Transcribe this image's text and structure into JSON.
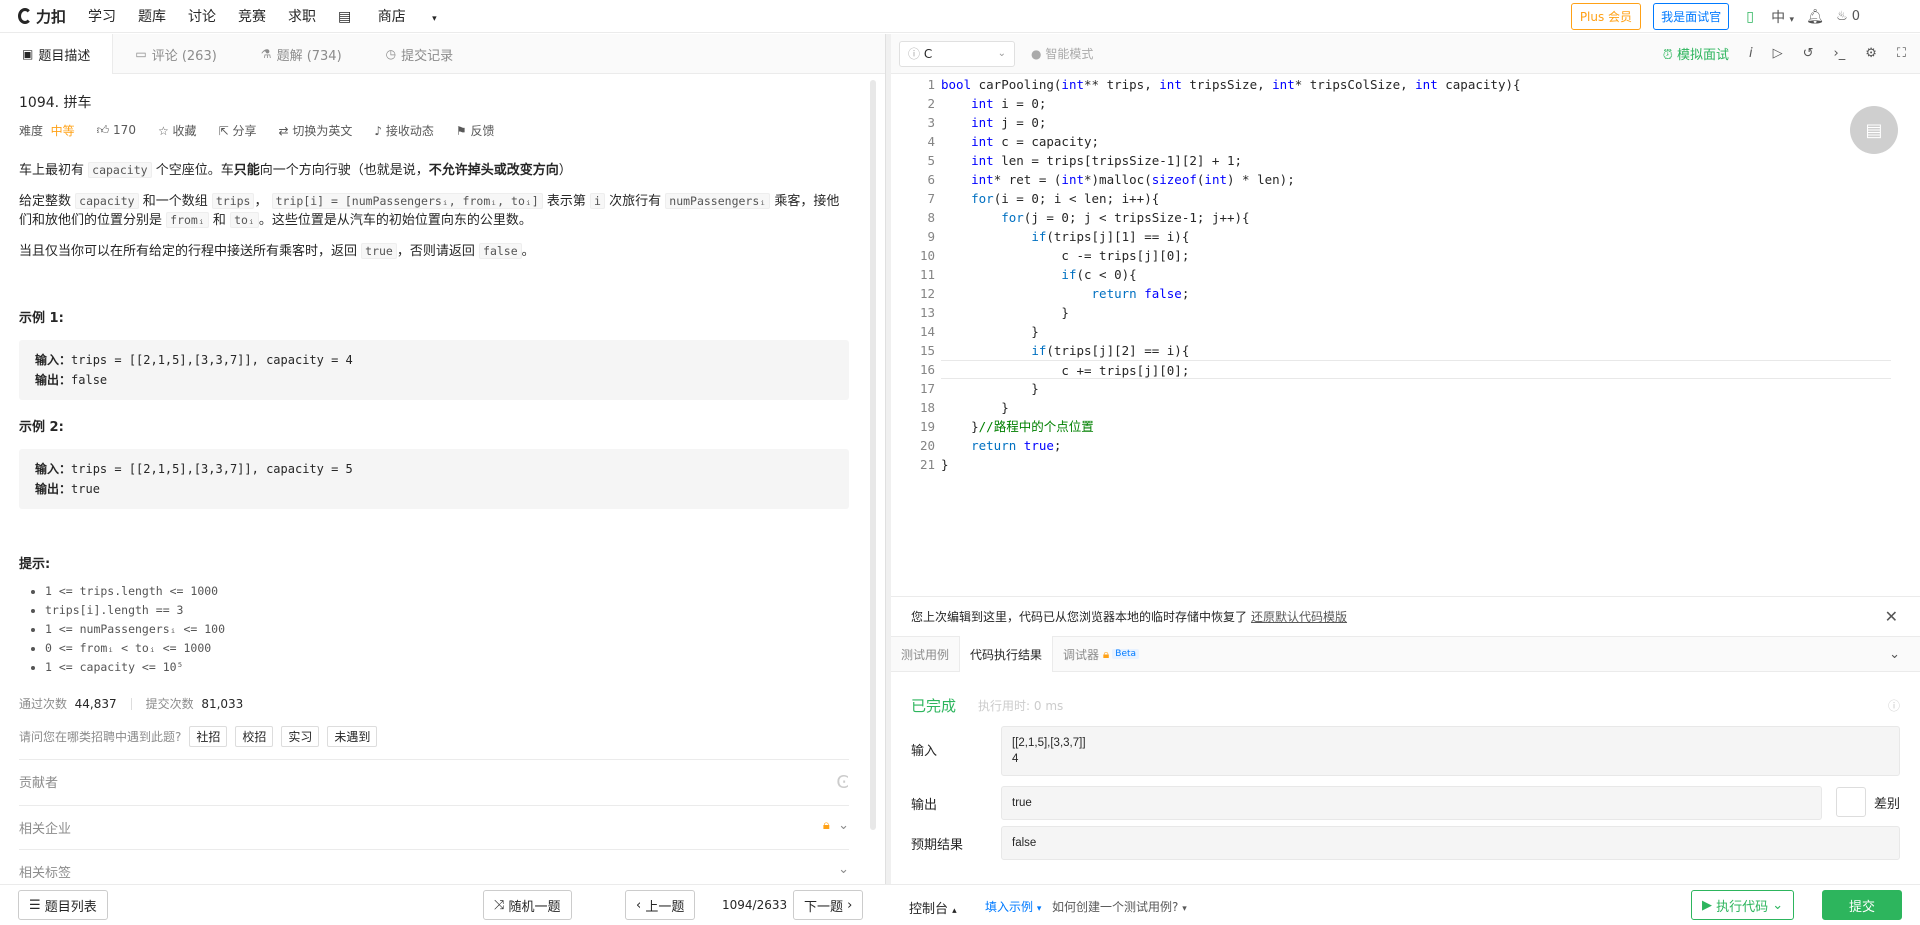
{
  "topbar": {
    "logo": "力扣",
    "nav": [
      "学习",
      "题库",
      "讨论",
      "竞赛",
      "求职"
    ],
    "shop": "商店",
    "plus": "Plus 会员",
    "interviewer": "我是面试官",
    "lang": "中",
    "count": "0"
  },
  "left_tabs": [
    {
      "label": "题目描述"
    },
    {
      "label": "评论 (263)"
    },
    {
      "label": "题解 (734)"
    },
    {
      "label": "提交记录"
    }
  ],
  "problem": {
    "title": "1094. 拼车",
    "difficulty_label": "难度",
    "difficulty": "中等",
    "likes": "170",
    "collect": "收藏",
    "share": "分享",
    "switch_en": "切换为英文",
    "follow": "接收动态",
    "feedback": "反馈",
    "p1_a": "车上最初有",
    "p1_code": "capacity",
    "p1_b": "个空座位。车",
    "p1_bold1": "只能",
    "p1_c": "向一个方向行驶（也就是说，",
    "p1_bold2": "不允许掉头或改变方向",
    "p1_d": "）",
    "p2_a": "给定整数",
    "p2_code1": "capacity",
    "p2_b": "和一个数组",
    "p2_code2": "trips",
    "p2_c": "，",
    "p2_code3": "trip[i] = [numPassengersᵢ, fromᵢ, toᵢ]",
    "p2_d": "表示第",
    "p2_code4": "i",
    "p2_e": "次旅行有",
    "p2_code5": "numPassengersᵢ",
    "p2_f": "乘客，接他们和放他们的位置分别是",
    "p2_code6": "fromᵢ",
    "p2_g": "和",
    "p2_code7": "toᵢ",
    "p2_h": "。这些位置是从汽车的初始位置向东的公里数。",
    "p3_a": "当且仅当你可以在所有给定的行程中接送所有乘客时，返回",
    "p3_code1": "true",
    "p3_b": "，否则请返回",
    "p3_code2": "false",
    "p3_c": "。",
    "ex1_title": "示例 1:",
    "ex1_in_label": "输入：",
    "ex1_in": "trips = [[2,1,5],[3,3,7]], capacity = 4",
    "ex1_out_label": "输出：",
    "ex1_out": "false",
    "ex2_title": "示例 2:",
    "ex2_in_label": "输入：",
    "ex2_in": "trips = [[2,1,5],[3,3,7]], capacity = 5",
    "ex2_out_label": "输出：",
    "ex2_out": "true",
    "hints_title": "提示:",
    "hints": [
      "1 <= trips.length <= 1000",
      "trips[i].length == 3",
      "1 <= numPassengersᵢ <= 100",
      "0 <= fromᵢ < toᵢ <= 1000",
      "1 <= capacity <= 10⁵"
    ],
    "pass_label": "通过次数",
    "pass_count": "44,837",
    "submit_label": "提交次数",
    "submit_count": "81,033",
    "recruit_q": "请问您在哪类招聘中遇到此题?",
    "recruit_options": [
      "社招",
      "校招",
      "实习",
      "未遇到"
    ],
    "contributors": "贡献者",
    "companies": "相关企业",
    "tags": "相关标签"
  },
  "editor": {
    "language": "C",
    "smart_mode": "智能模式",
    "mock": "模拟面试",
    "lines": [
      "bool carPooling(int** trips, int tripsSize, int* tripsColSize, int capacity){",
      "    int i = 0;",
      "    int j = 0;",
      "    int c = capacity;",
      "    int len = trips[tripsSize-1][2] + 1;",
      "    int* ret = (int*)malloc(sizeof(int) * len);",
      "    for(i = 0; i < len; i++){",
      "        for(j = 0; j < tripsSize-1; j++){",
      "            if(trips[j][1] == i){",
      "                c -= trips[j][0];",
      "                if(c < 0){",
      "                    return false;",
      "                }",
      "            }",
      "            if(trips[j][2] == i){",
      "                c += trips[j][0];",
      "            }",
      "        }",
      "    }//路程中的个点位置",
      "    return true;",
      "}"
    ]
  },
  "restore": {
    "text": "您上次编辑到这里，代码已从您浏览器本地的临时存储中恢复了",
    "link": "还原默认代码模版"
  },
  "result_tabs": [
    "测试用例",
    "代码执行结果",
    "调试器"
  ],
  "beta": "Beta",
  "result": {
    "status": "已完成",
    "time": "执行用时: 0 ms",
    "input_label": "输入",
    "input_line1": "[[2,1,5],[3,3,7]]",
    "input_line2": "4",
    "output_label": "输出",
    "output": "true",
    "diff_label": "差别",
    "expected_label": "预期结果",
    "expected": "false"
  },
  "bottom": {
    "list": "题目列表",
    "random": "随机一题",
    "prev": "上一题",
    "page": "1094/2633",
    "next": "下一题",
    "console": "控制台",
    "fill_example": "填入示例",
    "how_create": "如何创建一个测试用例?",
    "run": "执行代码",
    "submit": "提交"
  }
}
